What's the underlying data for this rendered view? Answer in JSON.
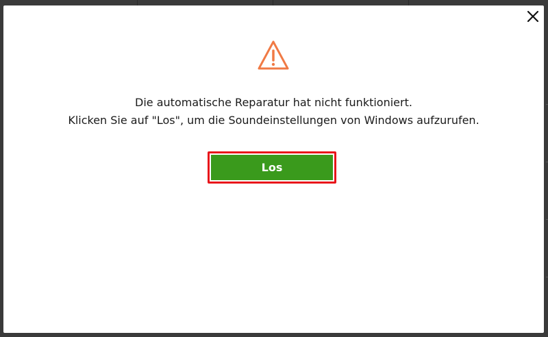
{
  "dialog": {
    "close_icon": "close-icon",
    "warning_icon": "warning-triangle-icon",
    "message_line1": "Die automatische Reparatur hat nicht funktioniert.",
    "message_line2": "Klicken Sie auf \"Los\", um die Soundeinstellungen von Windows aufzurufen.",
    "button_label": "Los"
  },
  "colors": {
    "warning": "#f07a45",
    "button_bg": "#3a9a1c",
    "highlight_border": "#e8141a",
    "dialog_bg": "#ffffff",
    "backdrop": "#3a3a3a"
  }
}
